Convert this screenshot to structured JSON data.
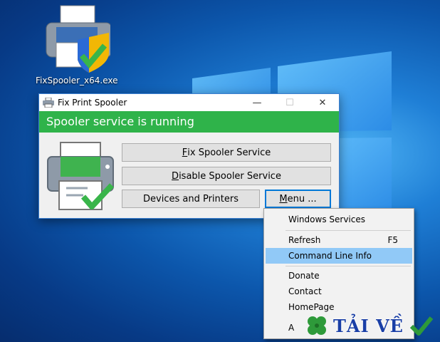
{
  "desktop": {
    "icon_label": "FixSpooler_x64.exe"
  },
  "window": {
    "title": "Fix Print Spooler",
    "minimize_glyph": "—",
    "maximize_glyph": "☐",
    "close_glyph": "✕",
    "status_text": "Spooler service is running",
    "status_color": "#2fb34a"
  },
  "buttons": {
    "fix_prefix": "",
    "fix_accel": "F",
    "fix_rest": "ix Spooler Service",
    "disable_accel": "D",
    "disable_rest": "isable Spooler Service",
    "devices": "Devices and Printers",
    "menu_accel": "M",
    "menu_rest": "enu ..."
  },
  "menu": {
    "items": [
      {
        "label": "Windows Services",
        "shortcut": ""
      },
      {
        "label": "Refresh",
        "shortcut": "F5"
      },
      {
        "label": "Command Line Info",
        "shortcut": ""
      },
      {
        "label": "Donate",
        "shortcut": ""
      },
      {
        "label": "Contact",
        "shortcut": ""
      },
      {
        "label": "HomePage",
        "shortcut": ""
      },
      {
        "label": "A",
        "shortcut": ""
      }
    ],
    "highlight_color": "#91c9f7"
  },
  "watermark": {
    "text": "TẢI VỀ"
  }
}
